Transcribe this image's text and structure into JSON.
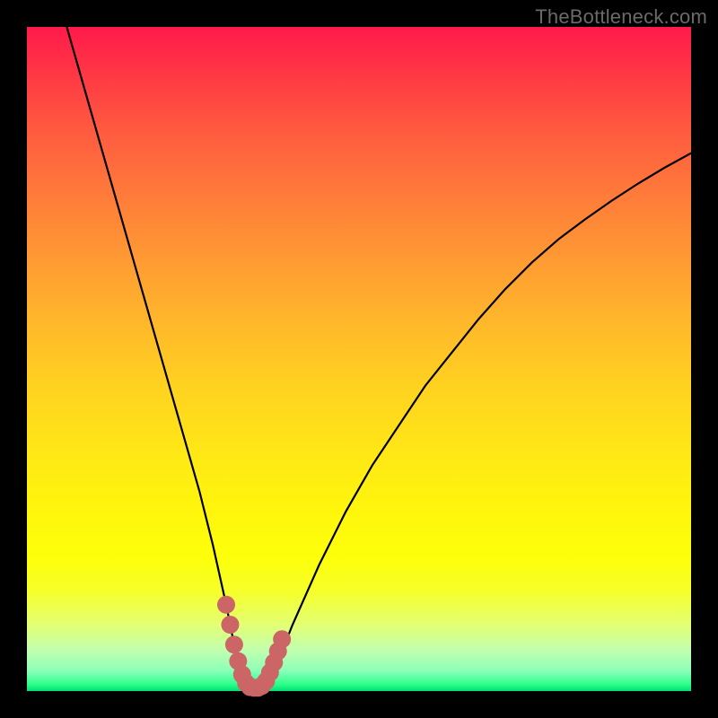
{
  "watermark": "TheBottleneck.com",
  "colors": {
    "frame": "#000000",
    "curve": "#000000",
    "marker_fill": "#cc6666",
    "marker_stroke": "#b84f4f"
  },
  "chart_data": {
    "type": "line",
    "title": "",
    "xlabel": "",
    "ylabel": "",
    "xlim": [
      0,
      100
    ],
    "ylim": [
      0,
      100
    ],
    "grid": false,
    "legend": false,
    "series": [
      {
        "name": "bottleneck-curve",
        "x": [
          6,
          8,
          10,
          12,
          14,
          16,
          18,
          20,
          22,
          24,
          26,
          28,
          30,
          31,
          32,
          33,
          34,
          35,
          36,
          38,
          40,
          44,
          48,
          52,
          56,
          60,
          64,
          68,
          72,
          76,
          80,
          84,
          88,
          92,
          96,
          100
        ],
        "y": [
          100,
          93,
          86,
          79,
          72,
          65,
          58,
          51,
          44,
          37,
          30,
          22,
          13,
          8,
          4,
          1.2,
          0.5,
          0.5,
          1.2,
          5,
          10,
          19,
          27,
          34,
          40,
          46,
          51,
          56,
          60.5,
          64.5,
          68,
          71,
          73.8,
          76.4,
          78.8,
          81
        ]
      }
    ],
    "markers": {
      "name": "optimal-range",
      "points": [
        {
          "x": 30.0,
          "y": 13.0
        },
        {
          "x": 30.6,
          "y": 10.0
        },
        {
          "x": 31.2,
          "y": 7.0
        },
        {
          "x": 31.8,
          "y": 4.5
        },
        {
          "x": 32.4,
          "y": 2.5
        },
        {
          "x": 33.0,
          "y": 1.2
        },
        {
          "x": 33.6,
          "y": 0.6
        },
        {
          "x": 34.2,
          "y": 0.5
        },
        {
          "x": 34.8,
          "y": 0.5
        },
        {
          "x": 35.4,
          "y": 0.8
        },
        {
          "x": 36.0,
          "y": 1.5
        },
        {
          "x": 36.6,
          "y": 2.8
        },
        {
          "x": 37.2,
          "y": 4.3
        },
        {
          "x": 37.8,
          "y": 6.0
        },
        {
          "x": 38.4,
          "y": 7.8
        }
      ]
    }
  }
}
